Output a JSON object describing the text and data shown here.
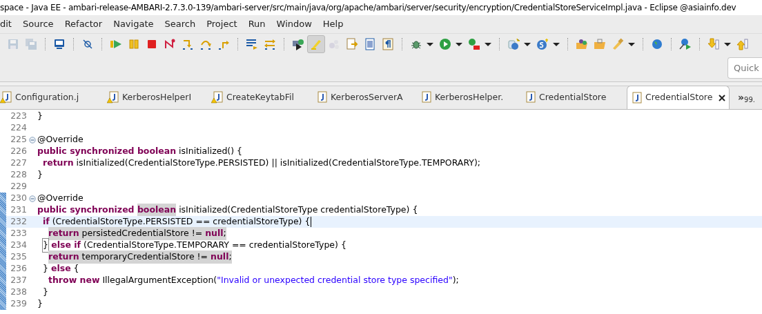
{
  "window": {
    "title": "space - Java EE - ambari-release-AMBARI-2.7.3.0-139/ambari-server/src/main/java/org/apache/ambari/server/security/encryption/CredentialStoreServiceImpl.java - Eclipse @asiainfo.dev"
  },
  "menu": [
    "dit",
    "Source",
    "Refactor",
    "Navigate",
    "Search",
    "Project",
    "Run",
    "Window",
    "Help"
  ],
  "toolbar": [
    {
      "kind": "save",
      "disabled": true,
      "selected": false,
      "dropdown": false
    },
    {
      "kind": "save-all",
      "disabled": true,
      "selected": false,
      "dropdown": false
    },
    {
      "kind": "separator"
    },
    {
      "kind": "monitor",
      "disabled": false,
      "selected": false,
      "dropdown": false
    },
    {
      "kind": "separator"
    },
    {
      "kind": "skip",
      "disabled": false,
      "selected": false,
      "dropdown": false
    },
    {
      "kind": "separator"
    },
    {
      "kind": "resume",
      "disabled": false,
      "selected": false,
      "dropdown": false
    },
    {
      "kind": "suspend",
      "disabled": false,
      "selected": false,
      "dropdown": false
    },
    {
      "kind": "terminate",
      "disabled": false,
      "selected": false,
      "dropdown": false
    },
    {
      "kind": "disconnect",
      "disabled": false,
      "selected": false,
      "dropdown": false
    },
    {
      "kind": "step-into",
      "disabled": false,
      "selected": false,
      "dropdown": false
    },
    {
      "kind": "step-over",
      "disabled": false,
      "selected": false,
      "dropdown": false
    },
    {
      "kind": "step-return",
      "disabled": false,
      "selected": false,
      "dropdown": false
    },
    {
      "kind": "separator"
    },
    {
      "kind": "list",
      "disabled": false,
      "selected": false,
      "dropdown": false
    },
    {
      "kind": "filter",
      "disabled": false,
      "selected": false,
      "dropdown": false
    },
    {
      "kind": "separator"
    },
    {
      "kind": "server",
      "disabled": false,
      "selected": false,
      "dropdown": false
    },
    {
      "kind": "pen",
      "disabled": false,
      "selected": true,
      "dropdown": false
    },
    {
      "kind": "bubbles",
      "disabled": true,
      "selected": false,
      "dropdown": false
    },
    {
      "kind": "document",
      "disabled": false,
      "selected": false,
      "dropdown": false
    },
    {
      "kind": "page",
      "disabled": false,
      "selected": false,
      "dropdown": false
    },
    {
      "kind": "pilcrow",
      "disabled": false,
      "selected": false,
      "dropdown": false
    },
    {
      "kind": "separator"
    },
    {
      "kind": "bug",
      "disabled": false,
      "selected": false,
      "dropdown": true
    },
    {
      "kind": "run",
      "disabled": false,
      "selected": false,
      "dropdown": true
    },
    {
      "kind": "run-toolbox",
      "disabled": false,
      "selected": false,
      "dropdown": true
    },
    {
      "kind": "separator"
    },
    {
      "kind": "new-globe",
      "disabled": false,
      "selected": false,
      "dropdown": true
    },
    {
      "kind": "new-s",
      "disabled": false,
      "selected": false,
      "dropdown": true
    },
    {
      "kind": "separator"
    },
    {
      "kind": "folder-balls",
      "disabled": false,
      "selected": false,
      "dropdown": false
    },
    {
      "kind": "folder",
      "disabled": false,
      "selected": false,
      "dropdown": false
    },
    {
      "kind": "torch",
      "disabled": false,
      "selected": false,
      "dropdown": true
    },
    {
      "kind": "separator"
    },
    {
      "kind": "globe",
      "disabled": false,
      "selected": false,
      "dropdown": false
    },
    {
      "kind": "separator"
    },
    {
      "kind": "deploy",
      "disabled": false,
      "selected": false,
      "dropdown": false
    },
    {
      "kind": "separator"
    },
    {
      "kind": "arrow-down",
      "disabled": false,
      "selected": false,
      "dropdown": true
    },
    {
      "kind": "arrow-up",
      "disabled": false,
      "selected": false,
      "dropdown": false
    }
  ],
  "quick_access": {
    "placeholder": "Quick"
  },
  "tabs": [
    {
      "label": "Configuration.j",
      "warning": true,
      "selected": false
    },
    {
      "label": "KerberosHelperI",
      "warning": true,
      "selected": false
    },
    {
      "label": "CreateKeytabFil",
      "warning": true,
      "selected": false
    },
    {
      "label": "KerberosServerA",
      "warning": false,
      "selected": false
    },
    {
      "label": "KerberosHelper.",
      "warning": false,
      "selected": false
    },
    {
      "label": "CredentialStore",
      "warning": false,
      "selected": false
    },
    {
      "label": "CredentialStore",
      "warning": false,
      "selected": true
    }
  ],
  "tab_overflow": {
    "label": "»",
    "count": "99."
  },
  "editor": {
    "lines": [
      {
        "number": "223",
        "kind": "top",
        "fold": false,
        "changed": false,
        "current": false,
        "caret": false,
        "tokens": [
          {
            "t": "}",
            "kind": "plain",
            "mark": false
          }
        ]
      },
      {
        "number": "224",
        "fold": false,
        "changed": false,
        "current": false,
        "caret": false
      },
      {
        "number": "225",
        "kind": "top",
        "fold": true,
        "changed": false,
        "current": false,
        "caret": false,
        "tokens": [
          {
            "t": "@Override",
            "kind": "plain",
            "mark": false
          }
        ]
      },
      {
        "number": "226",
        "kind": "top",
        "fold": false,
        "changed": false,
        "current": false,
        "caret": false,
        "tokens": [
          {
            "t": "public synchronized boolean",
            "kind": "keyword",
            "mark": false
          },
          {
            "t": " isInitialized() {",
            "kind": "plain",
            "mark": false
          }
        ]
      },
      {
        "number": "227",
        "kind": "body",
        "fold": false,
        "changed": false,
        "current": false,
        "caret": false,
        "tokens": [
          {
            "t": "return",
            "kind": "keyword",
            "mark": false
          },
          {
            "t": " isInitialized(CredentialStoreType.PERSISTED) || isInitialized(CredentialStoreType.TEMPORARY);",
            "kind": "plain",
            "mark": false
          }
        ]
      },
      {
        "number": "228",
        "kind": "top",
        "fold": false,
        "changed": false,
        "current": false,
        "caret": false,
        "tokens": [
          {
            "t": "}",
            "kind": "plain",
            "mark": false
          }
        ]
      },
      {
        "number": "229",
        "fold": false,
        "changed": false,
        "current": false,
        "caret": false
      },
      {
        "number": "230",
        "kind": "top",
        "fold": true,
        "changed": true,
        "current": false,
        "caret": false,
        "tokens": [
          {
            "t": "@Override",
            "kind": "plain",
            "mark": false
          }
        ]
      },
      {
        "number": "231",
        "kind": "top",
        "fold": false,
        "changed": true,
        "current": false,
        "caret": false,
        "tokens": [
          {
            "t": "public synchronized ",
            "kind": "keyword",
            "mark": false
          },
          {
            "t": "boolean",
            "kind": "keyword",
            "mark": true
          },
          {
            "t": " isInitialized(CredentialStoreType credentialStoreType) {",
            "kind": "plain",
            "mark": false
          }
        ]
      },
      {
        "number": "232",
        "kind": "body",
        "fold": false,
        "changed": true,
        "current": true,
        "caret": true,
        "tokens": [
          {
            "t": "if",
            "kind": "keyword",
            "mark": false
          },
          {
            "t": " (CredentialStoreType.PERSISTED == credentialStoreType) {",
            "kind": "plain",
            "mark": false
          }
        ]
      },
      {
        "number": "233",
        "kind": "inner",
        "fold": false,
        "changed": true,
        "current": false,
        "caret": false,
        "tokens": [
          {
            "t": "return",
            "kind": "keyword",
            "mark": true
          },
          {
            "t": " persistedCredentialStore != ",
            "kind": "plain",
            "mark": true
          },
          {
            "t": "null",
            "kind": "keyword",
            "mark": true
          },
          {
            "t": ";",
            "kind": "plain",
            "mark": true
          }
        ]
      },
      {
        "number": "234",
        "kind": "body",
        "fold": false,
        "changed": true,
        "current": false,
        "caret": false,
        "tokens": [
          {
            "t": "}",
            "kind": "bracket",
            "mark": false
          },
          {
            "t": " else if",
            "kind": "keyword",
            "mark": false
          },
          {
            "t": " (CredentialStoreType.TEMPORARY == credentialStoreType) {",
            "kind": "plain",
            "mark": false
          }
        ]
      },
      {
        "number": "235",
        "kind": "inner",
        "fold": false,
        "changed": true,
        "current": false,
        "caret": false,
        "tokens": [
          {
            "t": "return",
            "kind": "keyword",
            "mark": true
          },
          {
            "t": " temporaryCredentialStore != ",
            "kind": "plain",
            "mark": true
          },
          {
            "t": "null",
            "kind": "keyword",
            "mark": true
          },
          {
            "t": ";",
            "kind": "plain",
            "mark": true
          }
        ]
      },
      {
        "number": "236",
        "kind": "body",
        "fold": false,
        "changed": true,
        "current": false,
        "caret": false,
        "tokens": [
          {
            "t": "} ",
            "kind": "plain",
            "mark": false
          },
          {
            "t": "else",
            "kind": "keyword",
            "mark": false
          },
          {
            "t": " {",
            "kind": "plain",
            "mark": false
          }
        ]
      },
      {
        "number": "237",
        "kind": "inner",
        "fold": false,
        "changed": true,
        "current": false,
        "caret": false,
        "tokens": [
          {
            "t": "throw new",
            "kind": "keyword",
            "mark": false
          },
          {
            "t": " IllegalArgumentException(",
            "kind": "plain",
            "mark": false
          },
          {
            "t": "\"Invalid or unexpected credential store type specified\"",
            "kind": "string",
            "mark": false
          },
          {
            "t": ");",
            "kind": "plain",
            "mark": false
          }
        ]
      },
      {
        "number": "238",
        "kind": "body",
        "fold": false,
        "changed": true,
        "current": false,
        "caret": false,
        "tokens": [
          {
            "t": "}",
            "kind": "plain",
            "mark": false
          }
        ]
      },
      {
        "number": "239",
        "kind": "top",
        "fold": false,
        "changed": true,
        "current": false,
        "caret": false,
        "tokens": [
          {
            "t": "}",
            "kind": "plain",
            "mark": false
          }
        ]
      }
    ]
  }
}
